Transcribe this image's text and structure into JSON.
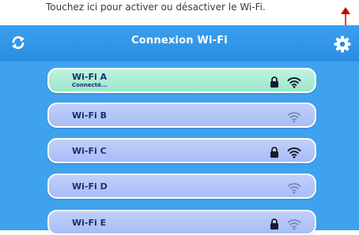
{
  "caption": "Touchez ici pour activer ou désactiver le Wi-Fi.",
  "header": {
    "title": "Connexion Wi-Fi"
  },
  "colors": {
    "header_bg": "#2a8ee0",
    "body_bg": "#3fa2ee",
    "item_bg": "#b3c4f7",
    "connected_bg": "#a8ecd2",
    "text": "#1a2f72",
    "annotation": "#cc0000"
  },
  "networks": [
    {
      "name": "Wi-Fi A",
      "status": "Connecté...",
      "locked": true,
      "signal": "full",
      "connected": true
    },
    {
      "name": "Wi-Fi B",
      "status": "",
      "locked": false,
      "signal": "weak",
      "connected": false
    },
    {
      "name": "Wi-Fi C",
      "status": "",
      "locked": true,
      "signal": "full",
      "connected": false
    },
    {
      "name": "Wi-Fi D",
      "status": "",
      "locked": false,
      "signal": "weak",
      "connected": false
    },
    {
      "name": "Wi-Fi E",
      "status": "",
      "locked": true,
      "signal": "weak",
      "connected": false
    }
  ],
  "icons": {
    "refresh": "refresh-icon",
    "settings": "gear-icon",
    "lock": "lock-icon",
    "wifi": "wifi-icon"
  }
}
